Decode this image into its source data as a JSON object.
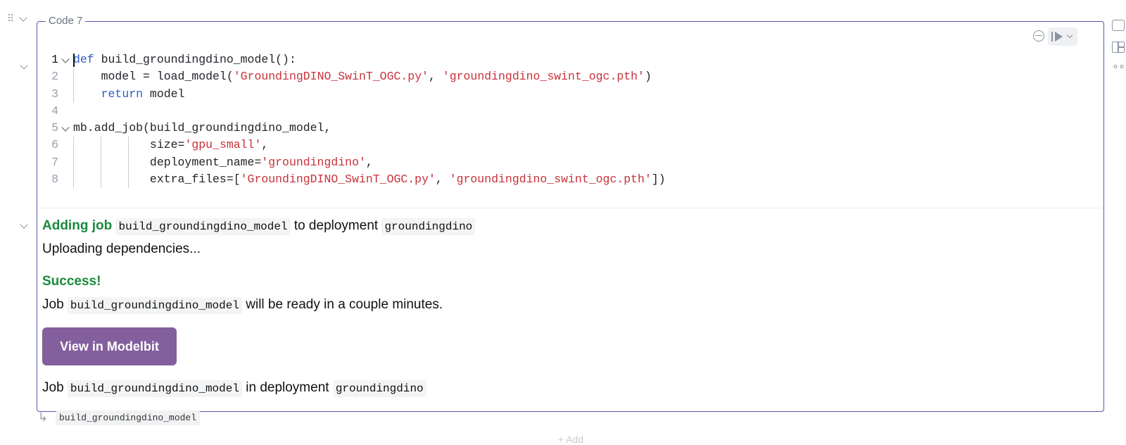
{
  "cell": {
    "label": "Code 7",
    "lines": [
      {
        "n": "1",
        "tokens": [
          {
            "t": "def",
            "c": "kw"
          },
          {
            "t": " build_groundingdino_model():"
          }
        ]
      },
      {
        "n": "2",
        "tokens": [
          {
            "t": "    model = load_model("
          },
          {
            "t": "'GroundingDINO_SwinT_OGC.py'",
            "c": "str"
          },
          {
            "t": ", "
          },
          {
            "t": "'groundingdino_swint_ogc.pth'",
            "c": "str"
          },
          {
            "t": ")"
          }
        ]
      },
      {
        "n": "3",
        "tokens": [
          {
            "t": "    "
          },
          {
            "t": "return",
            "c": "kw"
          },
          {
            "t": " model"
          }
        ]
      },
      {
        "n": "4",
        "tokens": []
      },
      {
        "n": "5",
        "tokens": [
          {
            "t": "mb.add_job(build_groundingdino_model,"
          }
        ]
      },
      {
        "n": "6",
        "tokens": [
          {
            "t": "           size="
          },
          {
            "t": "'gpu_small'",
            "c": "str"
          },
          {
            "t": ","
          }
        ]
      },
      {
        "n": "7",
        "tokens": [
          {
            "t": "           deployment_name="
          },
          {
            "t": "'groundingdino'",
            "c": "str"
          },
          {
            "t": ","
          }
        ]
      },
      {
        "n": "8",
        "tokens": [
          {
            "t": "           extra_files=["
          },
          {
            "t": "'GroundingDINO_SwinT_OGC.py'",
            "c": "str"
          },
          {
            "t": ", "
          },
          {
            "t": "'groundingdino_swint_ogc.pth'",
            "c": "str"
          },
          {
            "t": "])"
          }
        ]
      }
    ]
  },
  "output": {
    "adding_label": "Adding job",
    "job_name": "build_groundingdino_model",
    "to_deployment": "to deployment",
    "deployment_name": "groundingdino",
    "uploading": "Uploading dependencies...",
    "success": "Success!",
    "job_word": "Job",
    "ready_text": "will be ready in a couple minutes.",
    "button_label": "View in Modelbit",
    "in_deployment": "in deployment"
  },
  "return_value": "build_groundingdino_model",
  "add_hint": "+ Add",
  "colors": {
    "accent": "#5a55b0",
    "button": "#835f9e",
    "success": "#1a8a3b",
    "keyword": "#2f5fc4",
    "string": "#c8323a"
  }
}
